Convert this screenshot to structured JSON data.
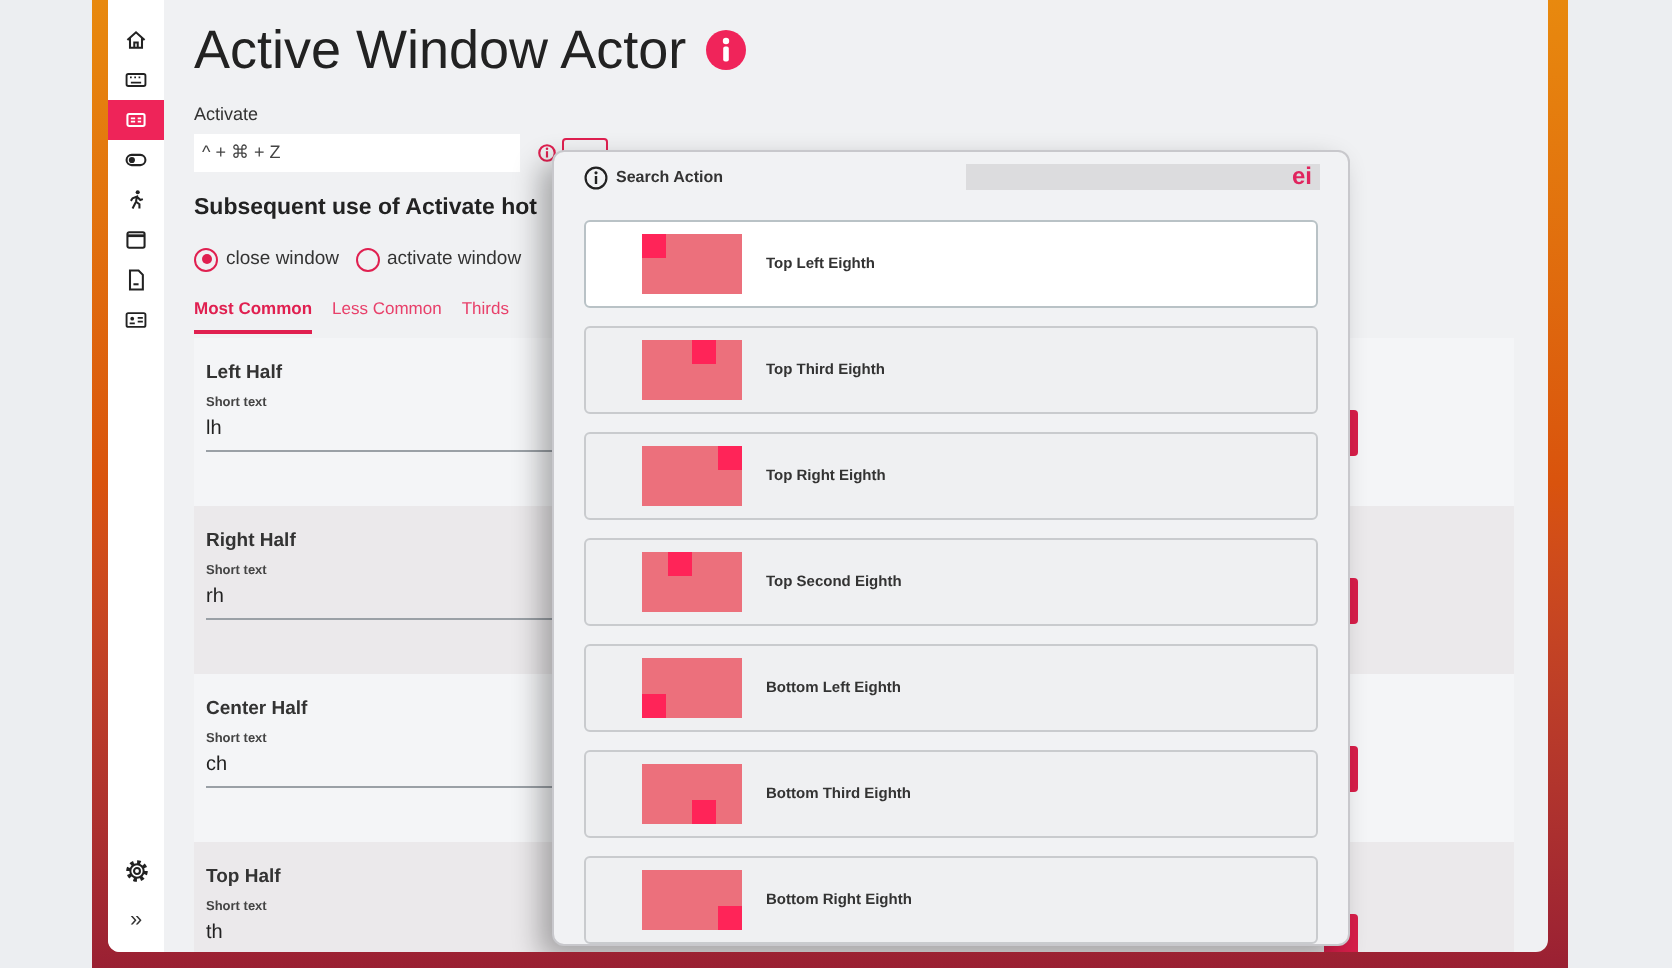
{
  "sidebar": {
    "items": [
      {
        "kind": "home",
        "selected": false
      },
      {
        "kind": "keyboard",
        "selected": false
      },
      {
        "kind": "actor",
        "selected": true
      },
      {
        "kind": "toggle",
        "selected": false
      },
      {
        "kind": "runner",
        "selected": false
      },
      {
        "kind": "window",
        "selected": false
      },
      {
        "kind": "document",
        "selected": false
      },
      {
        "kind": "card",
        "selected": false
      }
    ],
    "bottom": [
      {
        "kind": "settings"
      },
      {
        "kind": "expand",
        "text": "»"
      }
    ]
  },
  "title": "Active Window Actor",
  "activate": {
    "label": "Activate",
    "value": "^ + ⌘ + Z"
  },
  "subsequent": {
    "heading": "Subsequent use of Activate hot",
    "options": [
      {
        "label": "close window",
        "selected": true
      },
      {
        "label": "activate window",
        "selected": false
      }
    ]
  },
  "tabs": [
    {
      "label": "Most Common",
      "selected": true
    },
    {
      "label": "Less Common",
      "selected": false
    },
    {
      "label": "Thirds",
      "selected": false
    }
  ],
  "actions": [
    {
      "title": "Left Half",
      "field_label": "Short text",
      "value": "lh"
    },
    {
      "title": "Right Half",
      "field_label": "Short text",
      "value": "rh"
    },
    {
      "title": "Center Half",
      "field_label": "Short text",
      "value": "ch"
    },
    {
      "title": "Top Half",
      "field_label": "Short text",
      "value": "th"
    }
  ],
  "search_dialog": {
    "title": "Search Action",
    "query": "ei",
    "results": [
      {
        "label": "Top Left Eighth",
        "kind": "topleft",
        "selected": true
      },
      {
        "label": "Top Third Eighth",
        "kind": "topthird",
        "selected": false
      },
      {
        "label": "Top Right Eighth",
        "kind": "topright",
        "selected": false
      },
      {
        "label": "Top Second Eighth",
        "kind": "topsecond",
        "selected": false
      },
      {
        "label": "Bottom Left Eighth",
        "kind": "bottomleft",
        "selected": false
      },
      {
        "label": "Bottom Third Eighth",
        "kind": "bottomthird",
        "selected": false
      },
      {
        "label": "Bottom Right Eighth",
        "kind": "bottomright",
        "selected": false
      }
    ]
  }
}
